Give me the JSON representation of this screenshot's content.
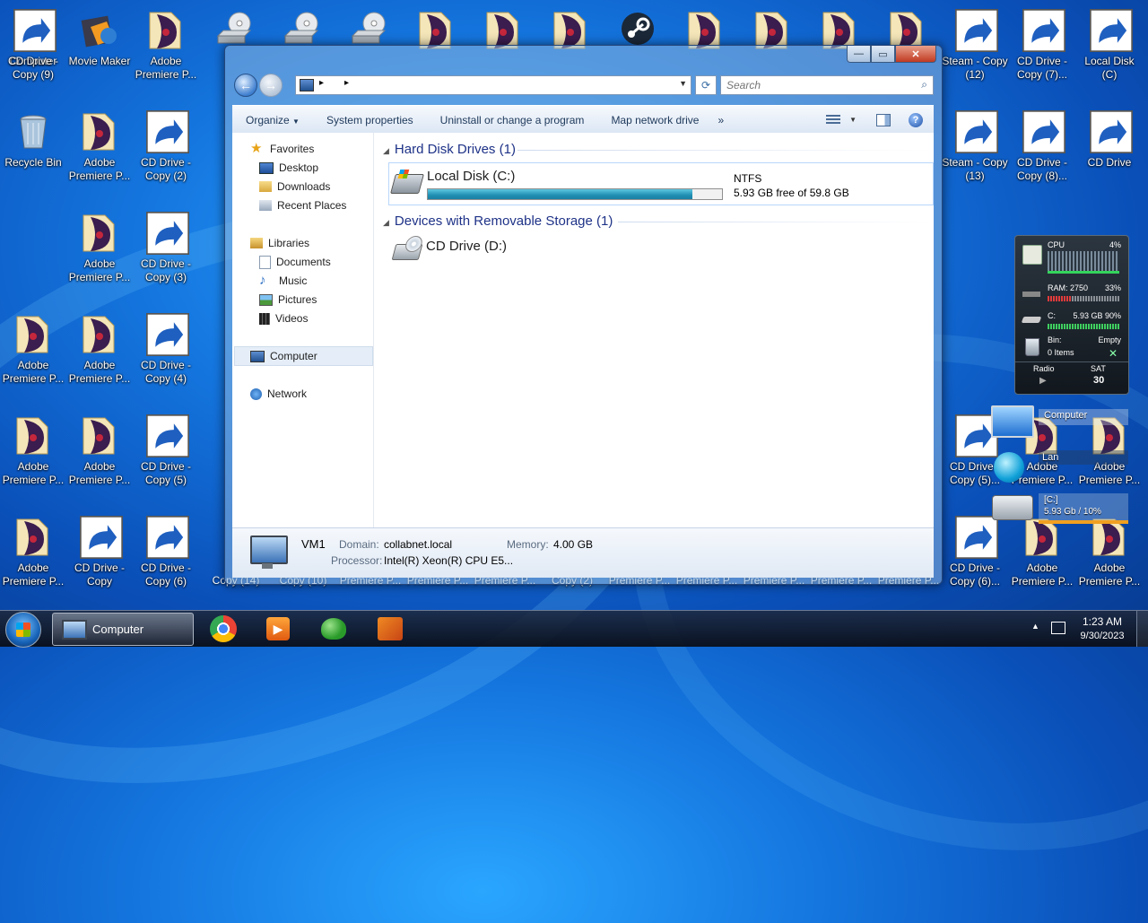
{
  "desktop": {
    "icons": [
      {
        "label": "Computer",
        "type": "computer",
        "col": 0,
        "row": 0
      },
      {
        "label": "Movie Maker",
        "type": "movie",
        "col": 1,
        "row": 0
      },
      {
        "label": "Adobe Premiere P...",
        "type": "premiere",
        "col": 2,
        "row": 0
      },
      {
        "label": "CD Drive - Copy (9)",
        "type": "cd",
        "col": 3,
        "row": 0
      },
      {
        "label": "Recycle Bin",
        "type": "bin",
        "col": 0,
        "row": 1
      },
      {
        "label": "Adobe Premiere P...",
        "type": "premiere",
        "col": 1,
        "row": 1
      },
      {
        "label": "CD Drive - Copy (2)",
        "type": "cd",
        "col": 2,
        "row": 1
      },
      {
        "label": "Adobe Premiere P...",
        "type": "premiere",
        "col": 1,
        "row": 2
      },
      {
        "label": "CD Drive - Copy (3)",
        "type": "cd",
        "col": 2,
        "row": 2
      },
      {
        "label": "Adobe Premiere P...",
        "type": "premiere",
        "col": 0,
        "row": 3
      },
      {
        "label": "Adobe Premiere P...",
        "type": "premiere",
        "col": 1,
        "row": 3
      },
      {
        "label": "CD Drive - Copy (4)",
        "type": "cd",
        "col": 2,
        "row": 3
      },
      {
        "label": "Adobe Premiere P...",
        "type": "premiere",
        "col": 0,
        "row": 4
      },
      {
        "label": "Adobe Premiere P...",
        "type": "premiere",
        "col": 1,
        "row": 4
      },
      {
        "label": "CD Drive - Copy (5)",
        "type": "cd",
        "col": 2,
        "row": 4
      },
      {
        "label": "Adobe Premiere P...",
        "type": "premiere",
        "col": 0,
        "row": 5
      },
      {
        "label": "CD Drive - Copy",
        "type": "cd",
        "col": 1,
        "row": 5
      },
      {
        "label": "CD Drive - Copy (6)",
        "type": "cd",
        "col": 2,
        "row": 5
      },
      {
        "label": "Steam - Copy (12)",
        "type": "steam",
        "col": 14,
        "row": 0
      },
      {
        "label": "CD Drive - Copy (7)...",
        "type": "cd",
        "col": 15,
        "row": 0
      },
      {
        "label": "Local Disk (C)",
        "type": "disk",
        "col": 16,
        "row": 0
      },
      {
        "label": "Steam - Copy (13)",
        "type": "steam",
        "col": 14,
        "row": 1
      },
      {
        "label": "CD Drive - Copy (8)...",
        "type": "cd",
        "col": 15,
        "row": 1
      },
      {
        "label": "CD Drive",
        "type": "cd",
        "col": 16,
        "row": 1
      },
      {
        "label": "CD Drive - Copy (5)...",
        "type": "cd",
        "col": 14,
        "row": 4
      },
      {
        "label": "Adobe Premiere P...",
        "type": "premiere",
        "col": 15,
        "row": 4
      },
      {
        "label": "Adobe Premiere P...",
        "type": "premiere",
        "col": 16,
        "row": 4
      },
      {
        "label": "CD Drive - Copy (6)...",
        "type": "cd",
        "col": 14,
        "row": 5
      },
      {
        "label": "Adobe Premiere P...",
        "type": "premiere",
        "col": 15,
        "row": 5
      },
      {
        "label": "Adobe Premiere P...",
        "type": "premiere",
        "col": 16,
        "row": 5
      }
    ],
    "top_partial": [
      "cd",
      "cd",
      "cd",
      "premiere",
      "premiere",
      "premiere",
      "steam",
      "premiere",
      "premiere",
      "premiere",
      "premiere"
    ],
    "bottom_partial_labels": [
      "Copy (14)",
      "Copy (10)",
      "Premiere P...",
      "Premiere P...",
      "Premiere P...",
      "Copy (2)",
      "Premiere P...",
      "Premiere P...",
      "Premiere P...",
      "Premiere P...",
      "Premiere P..."
    ]
  },
  "window": {
    "caption_buttons": {
      "minimize": "—",
      "maximize": "▭",
      "close": "✕"
    },
    "address": {
      "breadcrumb_arrow": "▸",
      "refresh": "⟳"
    },
    "search": {
      "placeholder": "Search"
    },
    "toolbar": {
      "organize": "Organize",
      "system_properties": "System properties",
      "uninstall": "Uninstall or change a program",
      "map_network": "Map network drive",
      "more": "»"
    },
    "nav": {
      "favorites": "Favorites",
      "desktop": "Desktop",
      "downloads": "Downloads",
      "recent": "Recent Places",
      "libraries": "Libraries",
      "documents": "Documents",
      "music": "Music",
      "pictures": "Pictures",
      "videos": "Videos",
      "computer": "Computer",
      "network": "Network"
    },
    "groups": {
      "hdd": "Hard Disk Drives (1)",
      "removable": "Devices with Removable Storage (1)"
    },
    "drive_c": {
      "name": "Local Disk (C:)",
      "fs": "NTFS",
      "free_text": "5.93 GB free of 59.8 GB",
      "used_fraction": 0.9
    },
    "drive_d": {
      "name": "CD Drive (D:)"
    },
    "details": {
      "name": "VM1",
      "domain_label": "Domain:",
      "domain_value": "collabnet.local",
      "memory_label": "Memory:",
      "memory_value": "4.00 GB",
      "processor_label": "Processor:",
      "processor_value": "Intel(R) Xeon(R) CPU E5..."
    }
  },
  "gadget": {
    "cpu_label": "CPU",
    "cpu_value": "4%",
    "ram_label": "RAM: 2750",
    "ram_value": "33%",
    "disk_label": "C:",
    "disk_value": "5.93 GB 90%",
    "bin_label": "Bin:",
    "bin_items": "0 Items",
    "bin_state": "Empty",
    "radio": "Radio",
    "day": "SAT",
    "date": "30"
  },
  "mini_gadget": {
    "computer": "Computer",
    "lan": "Lan",
    "disk": "[C:]",
    "disk_usage": "5.93 Gb / 10%"
  },
  "taskbar": {
    "active_window": "Computer",
    "time": "1:23 AM",
    "date": "9/30/2023"
  }
}
